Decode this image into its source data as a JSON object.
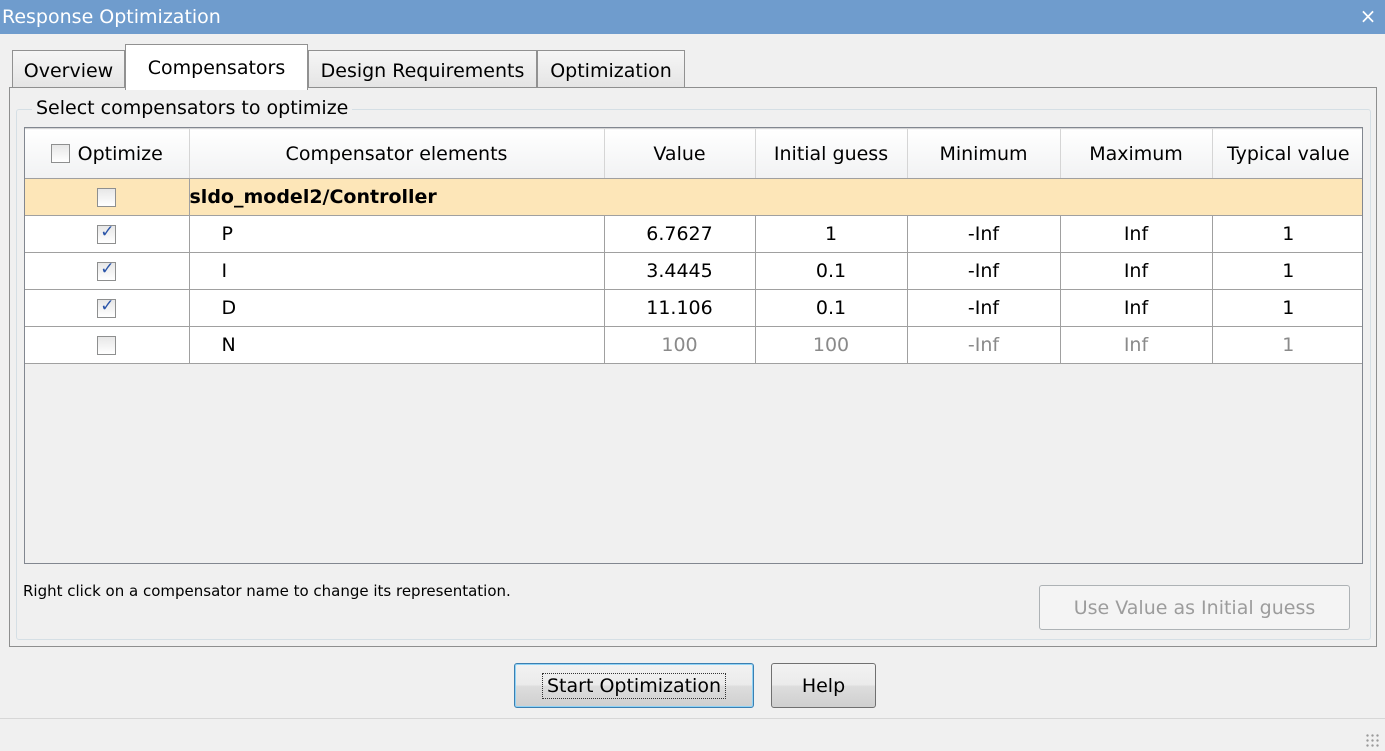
{
  "window": {
    "title": "Response Optimization",
    "close_glyph": "×"
  },
  "tabs": [
    {
      "label": "Overview",
      "active": false
    },
    {
      "label": "Compensators",
      "active": true
    },
    {
      "label": "Design Requirements",
      "active": false
    },
    {
      "label": "Optimization",
      "active": false
    }
  ],
  "group": {
    "legend": "Select compensators to optimize"
  },
  "table": {
    "columns": [
      "Optimize",
      "Compensator elements",
      "Value",
      "Initial guess",
      "Minimum",
      "Maximum",
      "Typical value"
    ],
    "group_row": {
      "name": "sldo_model2/Controller",
      "checked": false
    },
    "rows": [
      {
        "checked": true,
        "name": "P",
        "value": "6.7627",
        "initial": "1",
        "min": "-Inf",
        "max": "Inf",
        "typical": "1"
      },
      {
        "checked": true,
        "name": "I",
        "value": "3.4445",
        "initial": "0.1",
        "min": "-Inf",
        "max": "Inf",
        "typical": "1"
      },
      {
        "checked": true,
        "name": "D",
        "value": "11.106",
        "initial": "0.1",
        "min": "-Inf",
        "max": "Inf",
        "typical": "1"
      },
      {
        "checked": false,
        "name": "N",
        "value": "100",
        "initial": "100",
        "min": "-Inf",
        "max": "Inf",
        "typical": "1"
      }
    ]
  },
  "hint": "Right click on a compensator name to change its representation.",
  "buttons": {
    "use_value": "Use Value as Initial guess",
    "start": "Start Optimization",
    "help": "Help"
  },
  "colors": {
    "titlebar": "#6f9ccd",
    "group_row": "#fde6b8",
    "checkmark": "#2a54a8"
  }
}
